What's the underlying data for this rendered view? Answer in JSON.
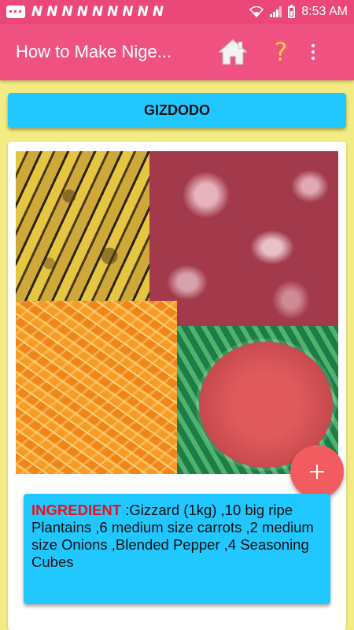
{
  "status_bar": {
    "notification_glyphs": [
      "N",
      "N",
      "N",
      "N",
      "N",
      "N",
      "N",
      "N",
      "N"
    ],
    "time": "8:53 AM",
    "icons": [
      "message-icon",
      "wifi-icon",
      "signal-icon",
      "battery-icon"
    ]
  },
  "app_bar": {
    "title": "How to Make Nige...",
    "help_symbol": "?",
    "icons": [
      "home-icon",
      "help-icon",
      "more-vert-icon"
    ],
    "colors": {
      "background": "#ef5280",
      "status": "#ec4779",
      "help": "#ffc94a"
    }
  },
  "recipe": {
    "title_button": "GIZDODO",
    "images": [
      "plantain",
      "gizzard",
      "pepper",
      "blended-pepper"
    ],
    "fab_symbol": "+",
    "ingredient_label": "INGREDIENT",
    "ingredient_text": " :Gizzard (1kg) ,10 big ripe Plantains ,6 medium size carrots ,2 medium size Onions ,Blended Pepper ,4 Seasoning Cubes"
  },
  "colors": {
    "page_bg": "#f3ec85",
    "accent_blue": "#21c7ff",
    "ingredient_red": "#e8131c",
    "fab": "#f25c60"
  }
}
